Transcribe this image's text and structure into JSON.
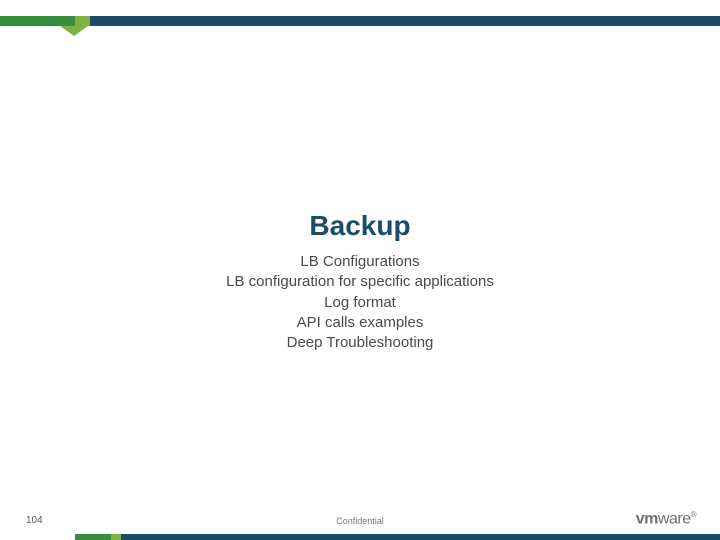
{
  "slide": {
    "title": "Backup",
    "subtitles": [
      "LB Configurations",
      "LB configuration for specific applications",
      "Log format",
      "API calls examples",
      "Deep Troubleshooting"
    ]
  },
  "footer": {
    "page_number": "104",
    "confidential": "Confidential",
    "logo_vm": "vm",
    "logo_ware": "ware",
    "logo_r": "®"
  }
}
